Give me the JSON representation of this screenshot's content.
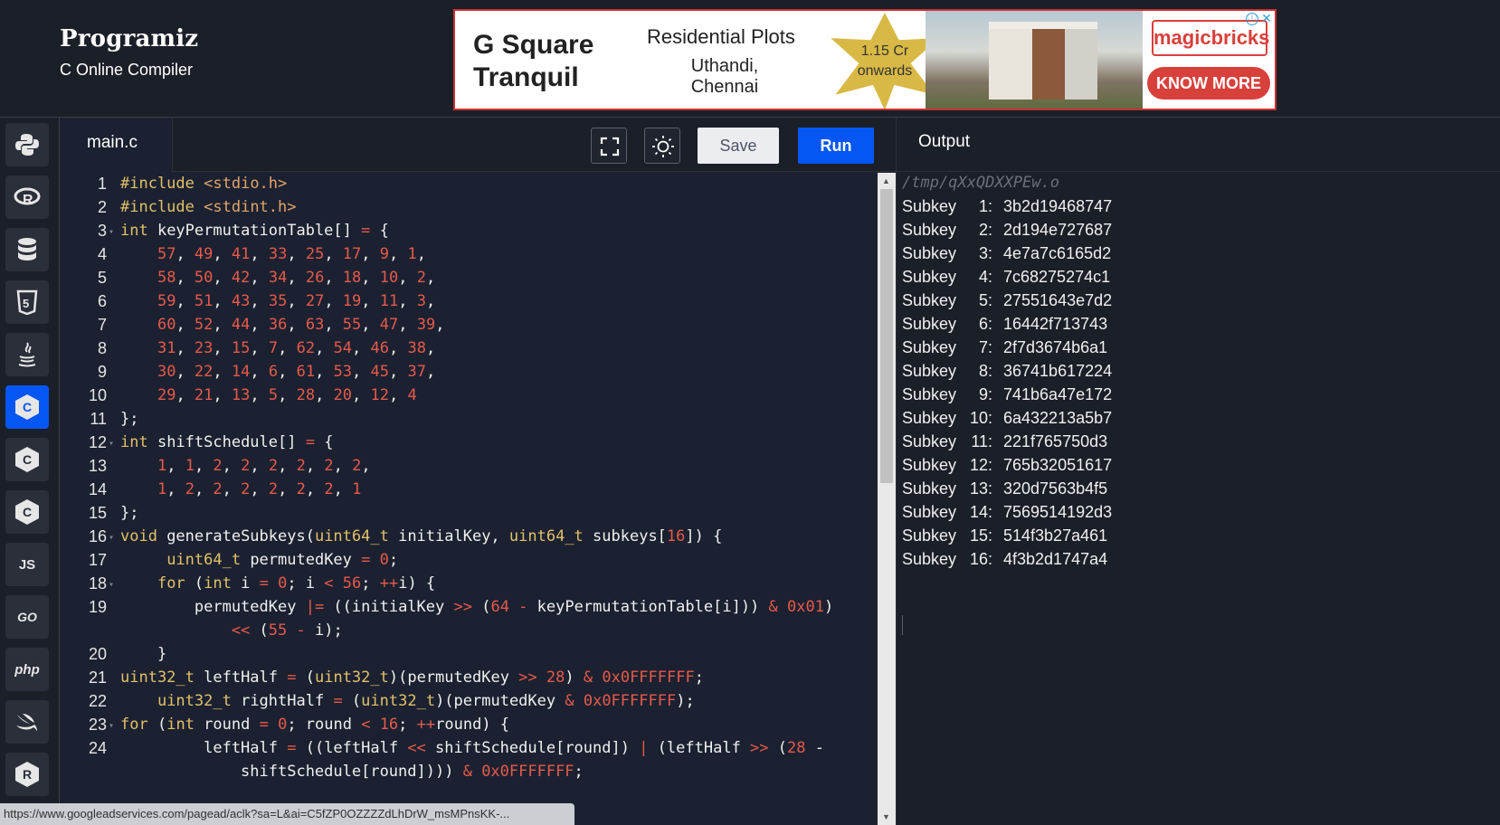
{
  "brand": {
    "logo": "Programiz",
    "tagline": "C Online Compiler"
  },
  "ad": {
    "brand_line1": "G Square",
    "brand_line2": "Tranquil",
    "heading": "Residential Plots",
    "location_line1": "Uthandi,",
    "location_line2": "Chennai",
    "price_line1": "1.15 Cr",
    "price_line2": "onwards",
    "advertiser": "magicbricks",
    "cta": "KNOW MORE",
    "info_icon": "ⓘ",
    "close_icon": "✕"
  },
  "sidebar": {
    "items": [
      {
        "name": "python",
        "icon": "python-icon"
      },
      {
        "name": "r",
        "icon": "r-icon"
      },
      {
        "name": "sql",
        "icon": "database-icon"
      },
      {
        "name": "html",
        "icon": "html5-icon",
        "label": "5"
      },
      {
        "name": "java",
        "icon": "java-icon"
      },
      {
        "name": "c",
        "icon": "c-icon",
        "label": "C",
        "active": true
      },
      {
        "name": "cpp",
        "icon": "cpp-icon",
        "label": "C"
      },
      {
        "name": "csharp",
        "icon": "csharp-icon",
        "label": "C"
      },
      {
        "name": "javascript",
        "icon": "js-icon",
        "label": "JS"
      },
      {
        "name": "go",
        "icon": "go-icon",
        "label": "GO"
      },
      {
        "name": "php",
        "icon": "php-icon",
        "label": "php"
      },
      {
        "name": "swift",
        "icon": "swift-icon"
      },
      {
        "name": "rust",
        "icon": "rust-icon",
        "label": "R"
      }
    ]
  },
  "editor": {
    "file_name": "main.c",
    "save_label": "Save",
    "run_label": "Run",
    "line_numbers": [
      "1",
      "2",
      "3",
      "4",
      "5",
      "6",
      "7",
      "8",
      "9",
      "10",
      "11",
      "12",
      "13",
      "14",
      "15",
      "16",
      "17",
      "18",
      "19",
      "",
      "20",
      "21",
      "22",
      "23",
      "24",
      ""
    ],
    "code_lines": [
      "#include <stdio.h>",
      "#include <stdint.h>",
      "int keyPermutationTable[] = {",
      "    57, 49, 41, 33, 25, 17, 9, 1,",
      "    58, 50, 42, 34, 26, 18, 10, 2,",
      "    59, 51, 43, 35, 27, 19, 11, 3,",
      "    60, 52, 44, 36, 63, 55, 47, 39,",
      "    31, 23, 15, 7, 62, 54, 46, 38,",
      "    30, 22, 14, 6, 61, 53, 45, 37,",
      "    29, 21, 13, 5, 28, 20, 12, 4",
      "};",
      "int shiftSchedule[] = {",
      "    1, 1, 2, 2, 2, 2, 2, 2,",
      "    1, 2, 2, 2, 2, 2, 2, 1",
      "};",
      "void generateSubkeys(uint64_t initialKey, uint64_t subkeys[16]) {",
      "     uint64_t permutedKey = 0;",
      "    for (int i = 0; i < 56; ++i) {",
      "        permutedKey |= ((initialKey >> (64 - keyPermutationTable[i])) & 0x01)",
      "            << (55 - i);",
      "    }",
      "uint32_t leftHalf = (uint32_t)(permutedKey >> 28) & 0x0FFFFFFF;",
      "    uint32_t rightHalf = (uint32_t)(permutedKey & 0x0FFFFFFF);",
      "for (int round = 0; round < 16; ++round) {",
      "         leftHalf = ((leftHalf << shiftSchedule[round]) | (leftHalf >> (28 -",
      "             shiftSchedule[round]))) & 0x0FFFFFFF;"
    ]
  },
  "output": {
    "title": "Output",
    "path": "/tmp/qXxQDXXPEw.o",
    "label": "Subkey",
    "lines": [
      {
        "n": "1:",
        "v": "3b2d19468747"
      },
      {
        "n": "2:",
        "v": "2d194e727687"
      },
      {
        "n": "3:",
        "v": "4e7a7c6165d2"
      },
      {
        "n": "4:",
        "v": "7c68275274c1"
      },
      {
        "n": "5:",
        "v": "27551643e7d2"
      },
      {
        "n": "6:",
        "v": "16442f713743"
      },
      {
        "n": "7:",
        "v": "2f7d3674b6a1"
      },
      {
        "n": "8:",
        "v": "36741b617224"
      },
      {
        "n": "9:",
        "v": "741b6a47e172"
      },
      {
        "n": "10:",
        "v": "6a432213a5b7"
      },
      {
        "n": "11:",
        "v": "221f765750d3"
      },
      {
        "n": "12:",
        "v": "765b32051617"
      },
      {
        "n": "13:",
        "v": "320d7563b4f5"
      },
      {
        "n": "14:",
        "v": "7569514192d3"
      },
      {
        "n": "15:",
        "v": "514f3b27a461"
      },
      {
        "n": "16:",
        "v": "4f3b2d1747a4"
      }
    ]
  },
  "status_url": "https://www.googleadservices.com/pagead/aclk?sa=L&ai=C5fZP0OZZZZdLhDrW_msMPnsKK-..."
}
